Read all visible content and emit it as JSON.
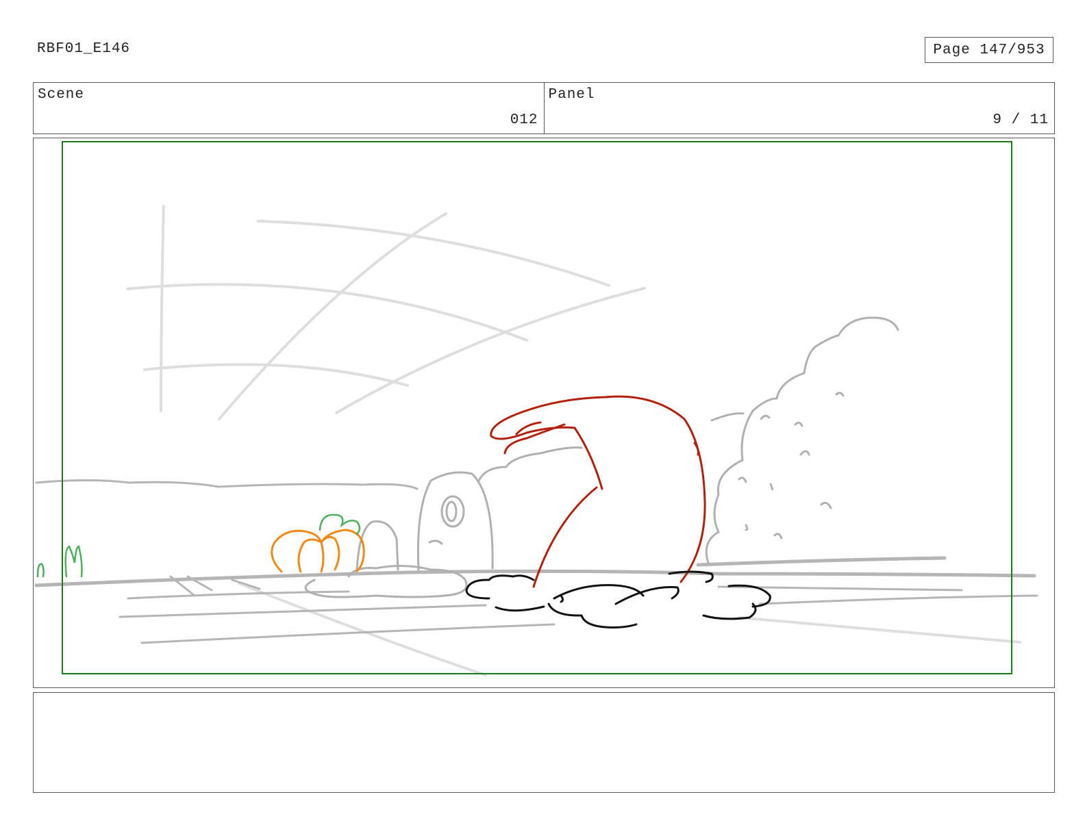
{
  "header": {
    "doc_id": "RBF01_E146",
    "page_label": "Page 147/953"
  },
  "info": {
    "scene_label": "Scene",
    "scene_value": "012",
    "panel_label": "Panel",
    "panel_value": "9 / 11"
  },
  "colors": {
    "safe_area": "#1a7a1a",
    "sketch_gray": "#b0b0b0",
    "sketch_light": "#dddddd",
    "character_red": "#b3200d",
    "pumpkin_orange": "#ef8a17",
    "stem_green": "#4caf5a",
    "dirt_black": "#111111"
  }
}
